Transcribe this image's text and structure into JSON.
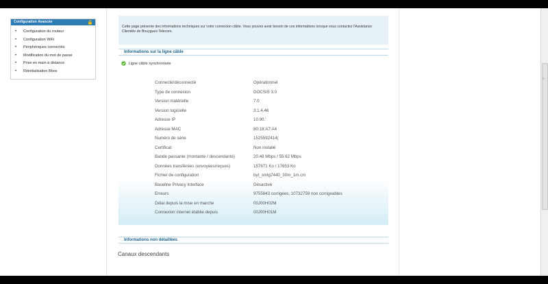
{
  "sidebar": {
    "header": "Configuration Avancée",
    "items": [
      "Configuration du routeur",
      "Configuration WiFi",
      "Périphériques connectés",
      "Modification du mot de passe",
      "Prise en main à distance",
      "Réinitialisation Bbox"
    ]
  },
  "intro": {
    "text": "Cette page présente des informations techniques sur votre connexion câble. Vous pouvez avoir besoin de ces informations lorsque vous contactez l'Assistance Clientèle de Bouygues Telecom."
  },
  "cable": {
    "title": "Informations sur la ligne câble",
    "status": "Ligne câble synchronisée",
    "rows": [
      {
        "label": "Connecté/déconnecté",
        "value": "Opérationnel"
      },
      {
        "label": "Type de connexion",
        "value": "DOCSIS 3.0"
      },
      {
        "label": "Version matérielle",
        "value": "7.0"
      },
      {
        "label": "Version logicielle",
        "value": "3.1.4.46"
      },
      {
        "label": "Adresse IP",
        "value": "10.90.'"
      },
      {
        "label": "Adresse MAC",
        "value": "80:18:A7:A4"
      },
      {
        "label": "Numéro de série",
        "value": "1525592414("
      },
      {
        "label": "Certificat",
        "value": "Non installé"
      },
      {
        "label": "Bande passante (montante / descendante)",
        "value": "20.48 Mbps / 55.62 Mbps"
      },
      {
        "label": "Données transférées (envoyées/reçues)",
        "value": "157671 Ko / 17653 Ko"
      },
      {
        "label": "Fichier de configuration",
        "value": "byt_smtg7440_30m_1m.cm"
      },
      {
        "label": "Baseline Privacy Interface",
        "value": "Désactivé"
      },
      {
        "label": "Erreurs",
        "value": "9755843 corrigées, 10732759 non corrigeables"
      },
      {
        "label": "Délai depuis la mise en marche",
        "value": "00J00H02M"
      },
      {
        "label": "Connexion internet établie depuis",
        "value": "00J00H01M"
      }
    ]
  },
  "details": {
    "title": "Informations non détaillées",
    "subtitle": "Canaux descendants"
  },
  "colors": {
    "accent": "#2d7bb5",
    "title_blue": "#1a5f8a",
    "intro_bg": "#e6f2f6",
    "status_green": "#5cb531"
  }
}
